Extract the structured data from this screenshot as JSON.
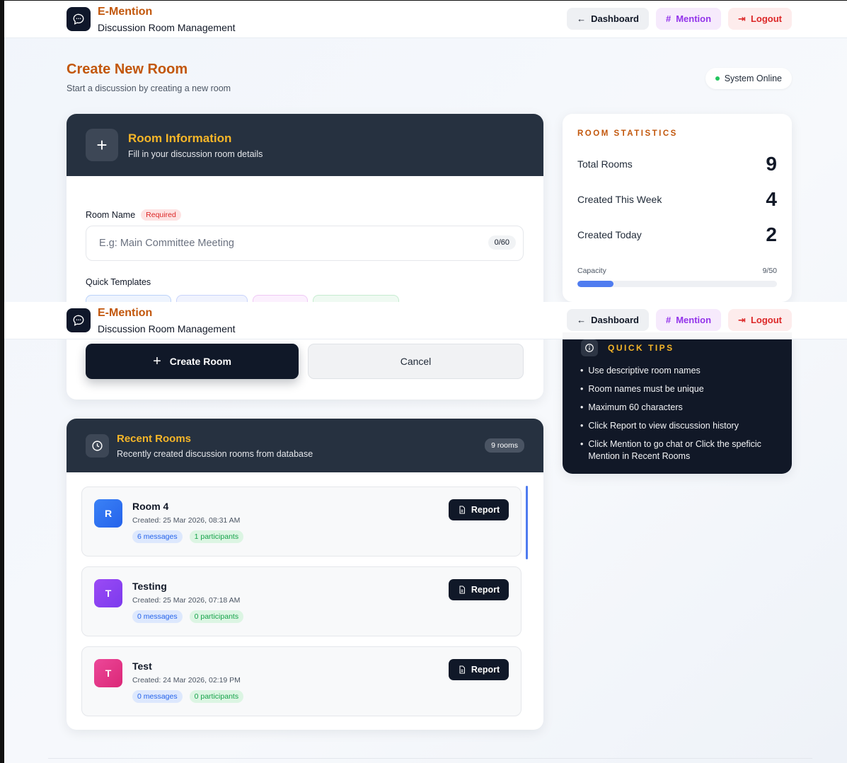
{
  "header": {
    "brand_title": "E-Mention",
    "brand_subtitle": "Discussion Room Management",
    "nav": {
      "dashboard": "Dashboard",
      "mention": "Mention",
      "logout": "Logout"
    }
  },
  "page": {
    "title": "Create New Room",
    "subtitle": "Start a discussion by creating a new room",
    "status": "System Online"
  },
  "form": {
    "title": "Room Information",
    "subtitle": "Fill in your discussion room details",
    "room_name_label": "Room Name",
    "required_badge": "Required",
    "room_name_placeholder": "E.g: Main Committee Meeting",
    "counter": "0/60",
    "quick_templates_label": "Quick Templates",
    "create_button": "Create Room",
    "cancel_button": "Cancel"
  },
  "stats": {
    "heading": "ROOM STATISTICS",
    "rows": [
      {
        "label": "Total Rooms",
        "value": "9"
      },
      {
        "label": "Created This Week",
        "value": "4"
      },
      {
        "label": "Created Today",
        "value": "2"
      }
    ],
    "capacity_label": "Capacity",
    "capacity_value": "9/50",
    "capacity_fraction": 0.18,
    "accent_color": "#4f7cf0"
  },
  "tips": {
    "heading": "QUICK TIPS",
    "items": [
      "Use descriptive room names",
      "Room names must be unique",
      "Maximum 60 characters",
      "Click Report to view discussion history",
      "Click Mention to go chat or Click the speficic Mention in Recent Rooms"
    ]
  },
  "recent": {
    "title": "Recent Rooms",
    "subtitle": "Recently created discussion rooms from database",
    "count_badge": "9 rooms",
    "report_label": "Report",
    "rooms": [
      {
        "initial": "R",
        "name": "Room 4",
        "created": "Created: 25 Mar 2026, 08:31 AM",
        "messages": "6 messages",
        "participants": "1 participants",
        "color": "#3b82f6"
      },
      {
        "initial": "T",
        "name": "Testing",
        "created": "Created: 25 Mar 2026, 07:18 AM",
        "messages": "0 messages",
        "participants": "0 participants",
        "color": "#8b3ff0"
      },
      {
        "initial": "T",
        "name": "Test",
        "created": "Created: 24 Mar 2026, 02:19 PM",
        "messages": "0 messages",
        "participants": "0 participants",
        "color": "#e0337a"
      }
    ]
  },
  "colors": {
    "brand_orange": "#c2570c",
    "header_dark": "#263140",
    "accent_yellow": "#f6b628",
    "mention_purple": "#9333ea",
    "logout_red": "#dc2626",
    "online_green": "#22c55e"
  }
}
